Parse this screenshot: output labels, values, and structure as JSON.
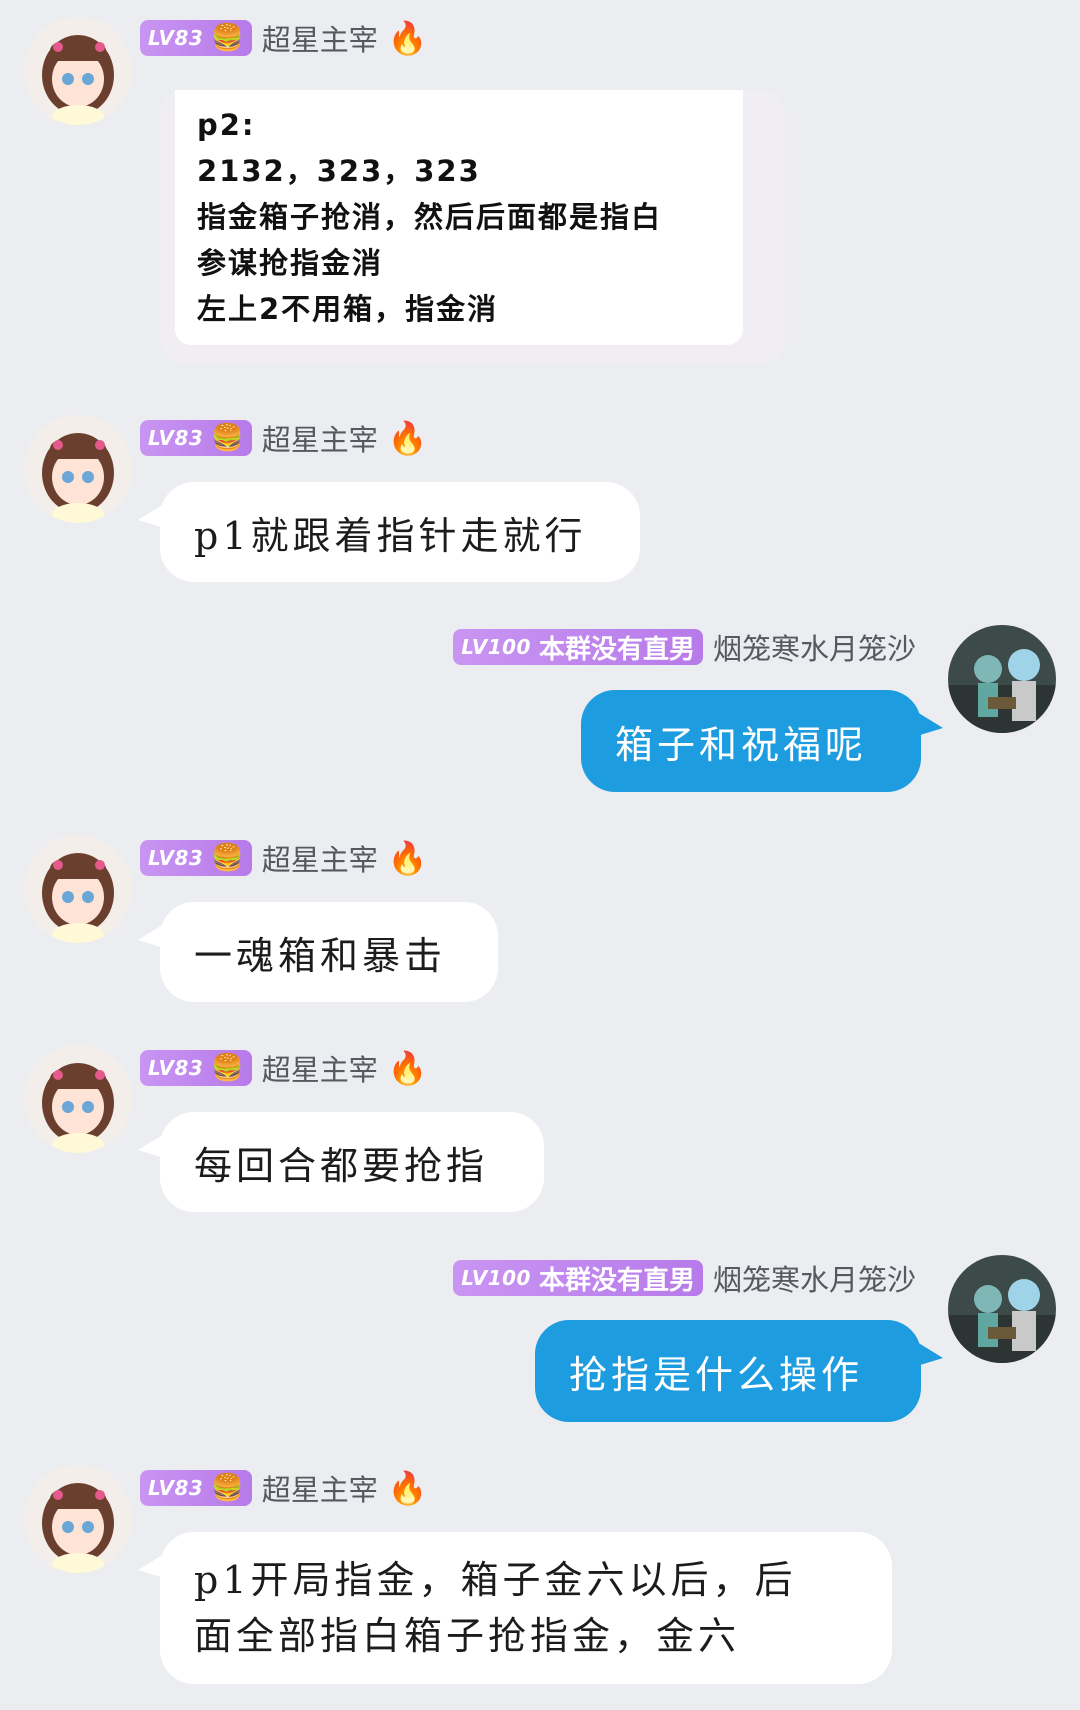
{
  "users": {
    "left": {
      "level": "LV83",
      "badge_emoji": "🍔",
      "name": "超星主宰",
      "suffix_emoji": "🔥"
    },
    "right": {
      "level": "LV100",
      "badge_title": "本群没有直男",
      "name": "烟笼寒水月笼沙"
    }
  },
  "messages": [
    {
      "from": "left",
      "kind": "card",
      "lines": [
        "p2:",
        "2132，323，323",
        "指金箱子抢消，然后后面都是指白",
        "参谋抢指金消",
        "左上2不用箱，指金消"
      ]
    },
    {
      "from": "left",
      "text": "p1就跟着指针走就行"
    },
    {
      "from": "right",
      "text": "箱子和祝福呢"
    },
    {
      "from": "left",
      "text": "一魂箱和暴击"
    },
    {
      "from": "left",
      "text": "每回合都要抢指"
    },
    {
      "from": "right",
      "text": "抢指是什么操作"
    },
    {
      "from": "left",
      "lines": [
        "p1开局指金，箱子金六以后，后",
        "面全部指白箱子抢指金，金六"
      ]
    }
  ]
}
